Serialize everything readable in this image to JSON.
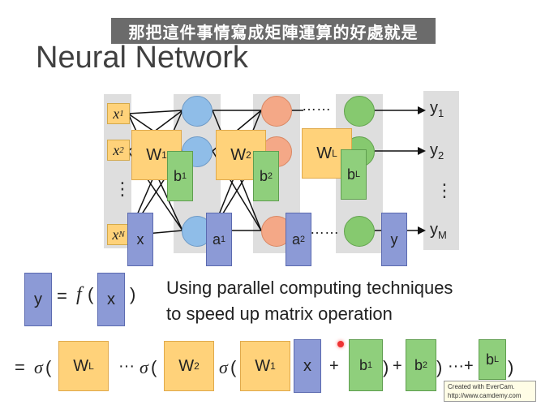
{
  "subtitle": "那把這件事情寫成矩陣運算的好處就是",
  "slide": {
    "title": "Neural Network",
    "inputs": {
      "x1": "x",
      "x1s": "1",
      "x2": "x",
      "x2s": "2",
      "xN": "x",
      "xNs": "N",
      "dots": "⋮"
    },
    "layer_boxes": {
      "w1": "W",
      "w1s": "1",
      "b1": "b",
      "b1s": "1",
      "w2": "W",
      "w2s": "2",
      "b2": "b",
      "b2s": "2",
      "wL": "W",
      "wLs": "L",
      "bL": "b",
      "bLs": "L",
      "x": "x",
      "a1": "a",
      "a1s": "1",
      "a2": "a",
      "a2s": "2",
      "y": "y"
    },
    "ellipsis_top": "……",
    "ellipsis_mid": "……",
    "outputs": {
      "y1": "y",
      "y1s": "1",
      "y2": "y",
      "y2s": "2",
      "yM": "y",
      "yMs": "M",
      "dots": "⋮"
    },
    "equation1": {
      "y": "y",
      "eq": "=",
      "f": "f",
      "open": "(",
      "x": "x",
      "close": ")"
    },
    "caption_line1": "Using parallel computing techniques",
    "caption_line2": "to speed up matrix operation",
    "equation2": {
      "eq": "=",
      "sigma": "σ",
      "open": "(",
      "wL": "W",
      "wLs": "L",
      "dots1": "···",
      "w2": "W",
      "w2s": "2",
      "w1": "W",
      "w1s": "1",
      "x": "x",
      "plus": "+",
      "b1": "b",
      "b1s": "1",
      "close": ")",
      "b2": "b",
      "b2s": "2",
      "dots2": "···+",
      "bL": "b",
      "bLs": "L"
    }
  },
  "watermark": {
    "line1": "Created with EverCam.",
    "line2": "http://www.camdemy.com"
  }
}
